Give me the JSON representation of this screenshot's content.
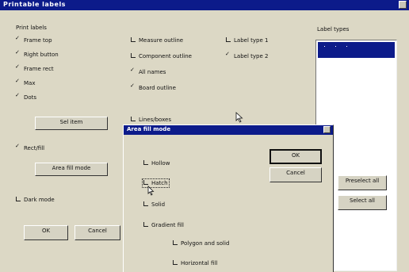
{
  "window": {
    "title": "Printable labels"
  },
  "group": {
    "title": "Print labels"
  },
  "checkboxes": [
    {
      "label": "Frame top",
      "checked": true
    },
    {
      "label": "Right button",
      "checked": true
    },
    {
      "label": "Frame rect",
      "checked": true
    },
    {
      "label": "Max",
      "checked": true
    },
    {
      "label": "Dots",
      "checked": true
    }
  ],
  "checkboxes_mid": [
    {
      "label": "Measure outline",
      "checked": false
    },
    {
      "label": "Component outline",
      "checked": false
    },
    {
      "label": "All names",
      "checked": true
    },
    {
      "label": "Board outline",
      "checked": true
    },
    {
      "label": "Lines/boxes",
      "checked": false
    }
  ],
  "checkboxes_right": [
    {
      "label": "Label type 1",
      "checked": false
    },
    {
      "label": "Label type 2",
      "checked": true
    }
  ],
  "buttons": {
    "select_label": "Sel item",
    "rect_radio_label": "Rect/fill",
    "rect_button_label": "Area fill mode",
    "dark_label": "Dark mode",
    "ok_label": "OK",
    "cancel_label": "Cancel",
    "preselect_label": "Preselect all",
    "select_all_label": "Select all"
  },
  "listbox": {
    "label": "Label types"
  },
  "dialog": {
    "title": "Area fill mode",
    "ok_label": "OK",
    "cancel_label": "Cancel",
    "options": [
      {
        "label": "Hollow",
        "checked": false
      },
      {
        "label": "Hatch",
        "checked": false
      },
      {
        "label": "Solid",
        "checked": false
      },
      {
        "label": "Gradient fill",
        "checked": false
      },
      {
        "label": "Polygon and solid",
        "checked": false
      },
      {
        "label": "Horizontal fill",
        "checked": false
      }
    ]
  }
}
